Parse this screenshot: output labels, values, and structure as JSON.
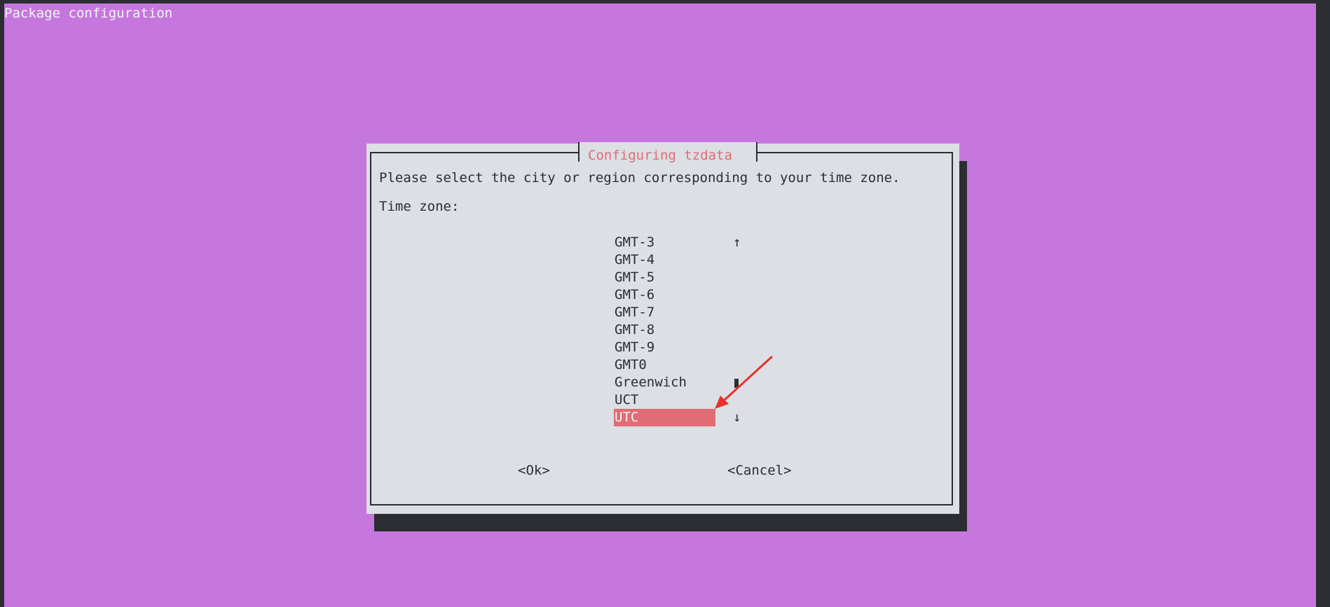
{
  "window": {
    "title": "Package configuration"
  },
  "dialog": {
    "title": "Configuring tzdata",
    "prompt": "Please select the city or region corresponding to your time zone.",
    "list_label": "Time zone:",
    "items": [
      "GMT-3",
      "GMT-4",
      "GMT-5",
      "GMT-6",
      "GMT-7",
      "GMT-8",
      "GMT-9",
      "GMT0",
      "Greenwich",
      "UCT",
      "UTC"
    ],
    "selected": "UTC",
    "scroll_up": "↑",
    "scroll_down": "↓",
    "ok_label": "<Ok>",
    "cancel_label": "<Cancel>"
  },
  "colors": {
    "background": "#c677dd",
    "dialog": "#dcdfe4",
    "accent": "#e06c75",
    "shadow": "#2b2d33",
    "annotation_arrow": "#e8322b"
  }
}
